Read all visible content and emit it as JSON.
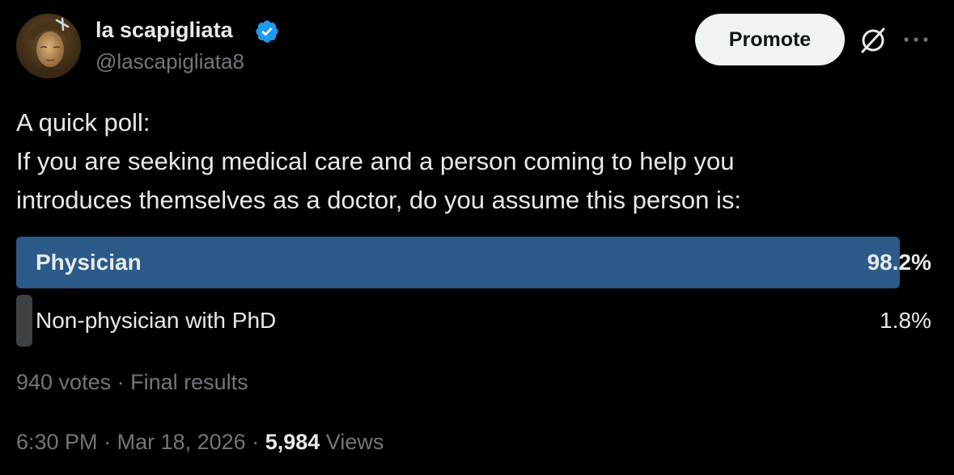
{
  "author": {
    "display_name": "la scapigliata",
    "handle": "@lascapigliata8",
    "verified": true,
    "avatar_icon": "portrait-avatar"
  },
  "header": {
    "promote_label": "Promote",
    "grok_icon": "grok-icon",
    "more_icon": "more-icon"
  },
  "tweet": {
    "lines": [
      "A quick poll:",
      "If you are seeking medical care and a person coming to help you",
      "introduces themselves as a doctor, do you assume this person is:"
    ]
  },
  "poll": {
    "options": [
      {
        "label": "Physician",
        "percent_text": "98.2%",
        "percent": 98.2,
        "winner": true
      },
      {
        "label": "Non-physician with PhD",
        "percent_text": "1.8%",
        "percent": 1.8,
        "winner": false
      }
    ],
    "votes": "940 votes",
    "status": "Final results"
  },
  "meta": {
    "time": "6:30 PM",
    "date": "Mar 18, 2026",
    "views_count": "5,984",
    "views_label": "Views"
  },
  "colors": {
    "background": "#000000",
    "winner_bar": "#2b5a88",
    "loser_bar": "#3e4144",
    "verified_badge": "#1d9bf0",
    "secondary_text": "#71767b",
    "primary_text": "#e7e9ea",
    "promote_bg": "#eff3f4"
  }
}
